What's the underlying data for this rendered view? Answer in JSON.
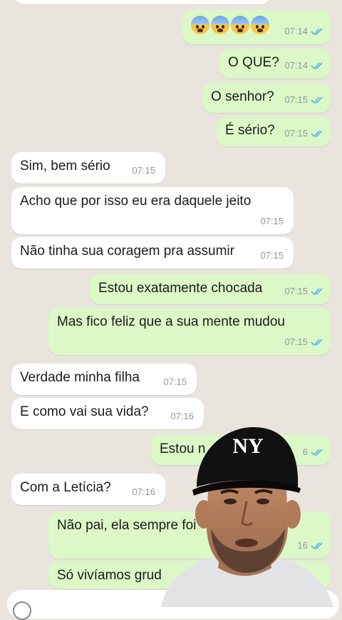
{
  "messages": [
    {
      "dir": "out",
      "text": "",
      "emoji_count": 4,
      "time": "07:14",
      "status": "read"
    },
    {
      "dir": "out",
      "text": "O QUE?",
      "time": "07:14",
      "status": "read"
    },
    {
      "dir": "out",
      "text": "O senhor?",
      "time": "07:15",
      "status": "read"
    },
    {
      "dir": "out",
      "text": "É sério?",
      "time": "07:15",
      "status": "read"
    },
    {
      "dir": "in",
      "text": "Sim, bem sério",
      "time": "07:15"
    },
    {
      "dir": "in",
      "text": "Acho que por isso eu era daquele jeito",
      "time": "07:15"
    },
    {
      "dir": "in",
      "text": "Não tinha sua coragem pra assumir",
      "time": "07:15"
    },
    {
      "dir": "out",
      "text": "Estou exatamente chocada",
      "time": "07:15",
      "status": "read"
    },
    {
      "dir": "out",
      "text": "Mas fico feliz que a sua mente mudou",
      "time": "07:15",
      "status": "read"
    },
    {
      "dir": "in",
      "text": "Verdade minha filha",
      "time": "07:15"
    },
    {
      "dir": "in",
      "text": "E como vai sua vida?",
      "time": "07:16"
    },
    {
      "dir": "out",
      "text": "Estou n",
      "time": "6",
      "status": "read"
    },
    {
      "dir": "in",
      "text": "Com a Letícia?",
      "time": "07:16"
    },
    {
      "dir": "out",
      "text": "Não pai, ela sempre foi",
      "time": "16",
      "status": "read"
    },
    {
      "dir": "out",
      "text": "Só vivíamos grud",
      "time": "",
      "status": ""
    }
  ],
  "overlay": {
    "cap_logo": "NY"
  },
  "colors": {
    "outgoing": "#dcf8c6",
    "incoming": "#ffffff",
    "background": "#e9e5de",
    "read_tick": "#4fb6ec",
    "time": "#8a9aa0"
  }
}
